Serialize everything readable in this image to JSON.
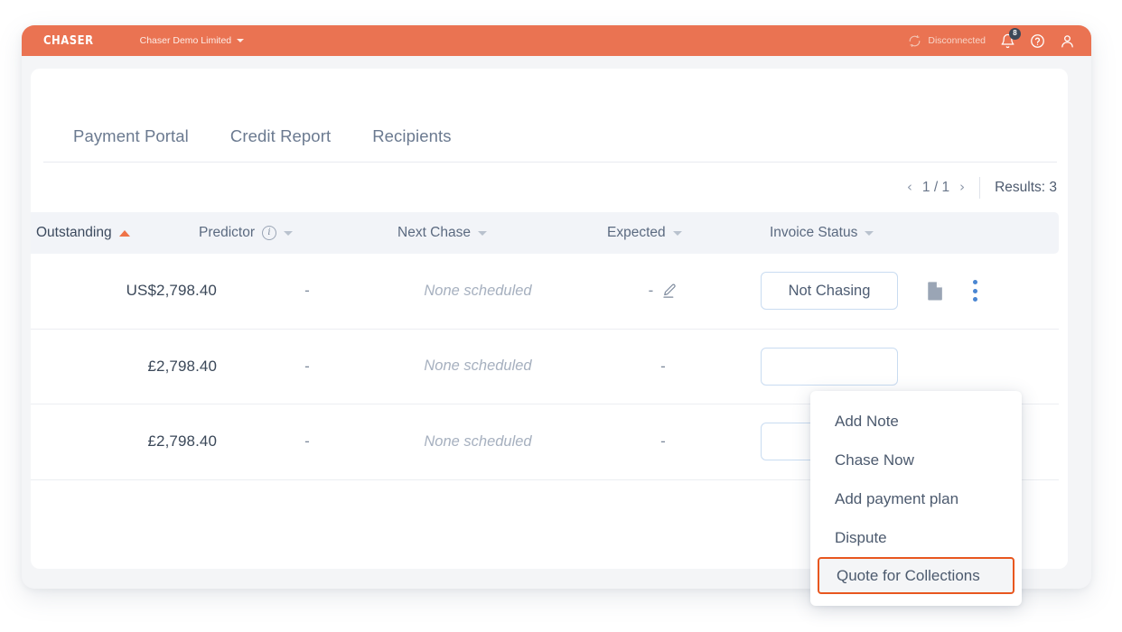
{
  "topbar": {
    "brand": "CHASER",
    "org_name": "Chaser Demo Limited",
    "connection_status": "Disconnected",
    "notification_count": "8",
    "sync_icon": "sync-disconnected-icon",
    "bell_icon": "bell-icon",
    "help_icon": "help-circle-icon",
    "account_icon": "user-account-icon",
    "accent_color": "#ea7352"
  },
  "tabs": [
    {
      "label": "Payment Portal"
    },
    {
      "label": "Credit Report"
    },
    {
      "label": "Recipients"
    }
  ],
  "pagination": {
    "prev": "‹",
    "page": "1 / 1",
    "next": "›",
    "results": "Results: 3"
  },
  "table": {
    "columns": [
      {
        "label": "Outstanding",
        "sorted": "asc",
        "has_info": false
      },
      {
        "label": "Predictor",
        "sorted": "none",
        "has_info": true
      },
      {
        "label": "Next Chase",
        "sorted": "none",
        "has_info": false
      },
      {
        "label": "Expected",
        "sorted": "none",
        "has_info": false
      },
      {
        "label": "Invoice Status",
        "sorted": "none",
        "has_info": false
      }
    ],
    "rows": [
      {
        "outstanding": "US$2,798.40",
        "predictor": "-",
        "next_chase": "None scheduled",
        "expected": "-",
        "status": "Not Chasing"
      },
      {
        "outstanding": "£2,798.40",
        "predictor": "-",
        "next_chase": "None scheduled",
        "expected": "-",
        "status": ""
      },
      {
        "outstanding": "£2,798.40",
        "predictor": "-",
        "next_chase": "None scheduled",
        "expected": "-",
        "status": ""
      }
    ]
  },
  "context_menu": {
    "items": [
      {
        "label": "Add Note",
        "highlighted": false
      },
      {
        "label": "Chase Now",
        "highlighted": false
      },
      {
        "label": "Add payment plan",
        "highlighted": false
      },
      {
        "label": "Dispute",
        "highlighted": false
      },
      {
        "label": "Quote for Collections",
        "highlighted": true
      }
    ],
    "highlight_color": "#e8571f"
  }
}
